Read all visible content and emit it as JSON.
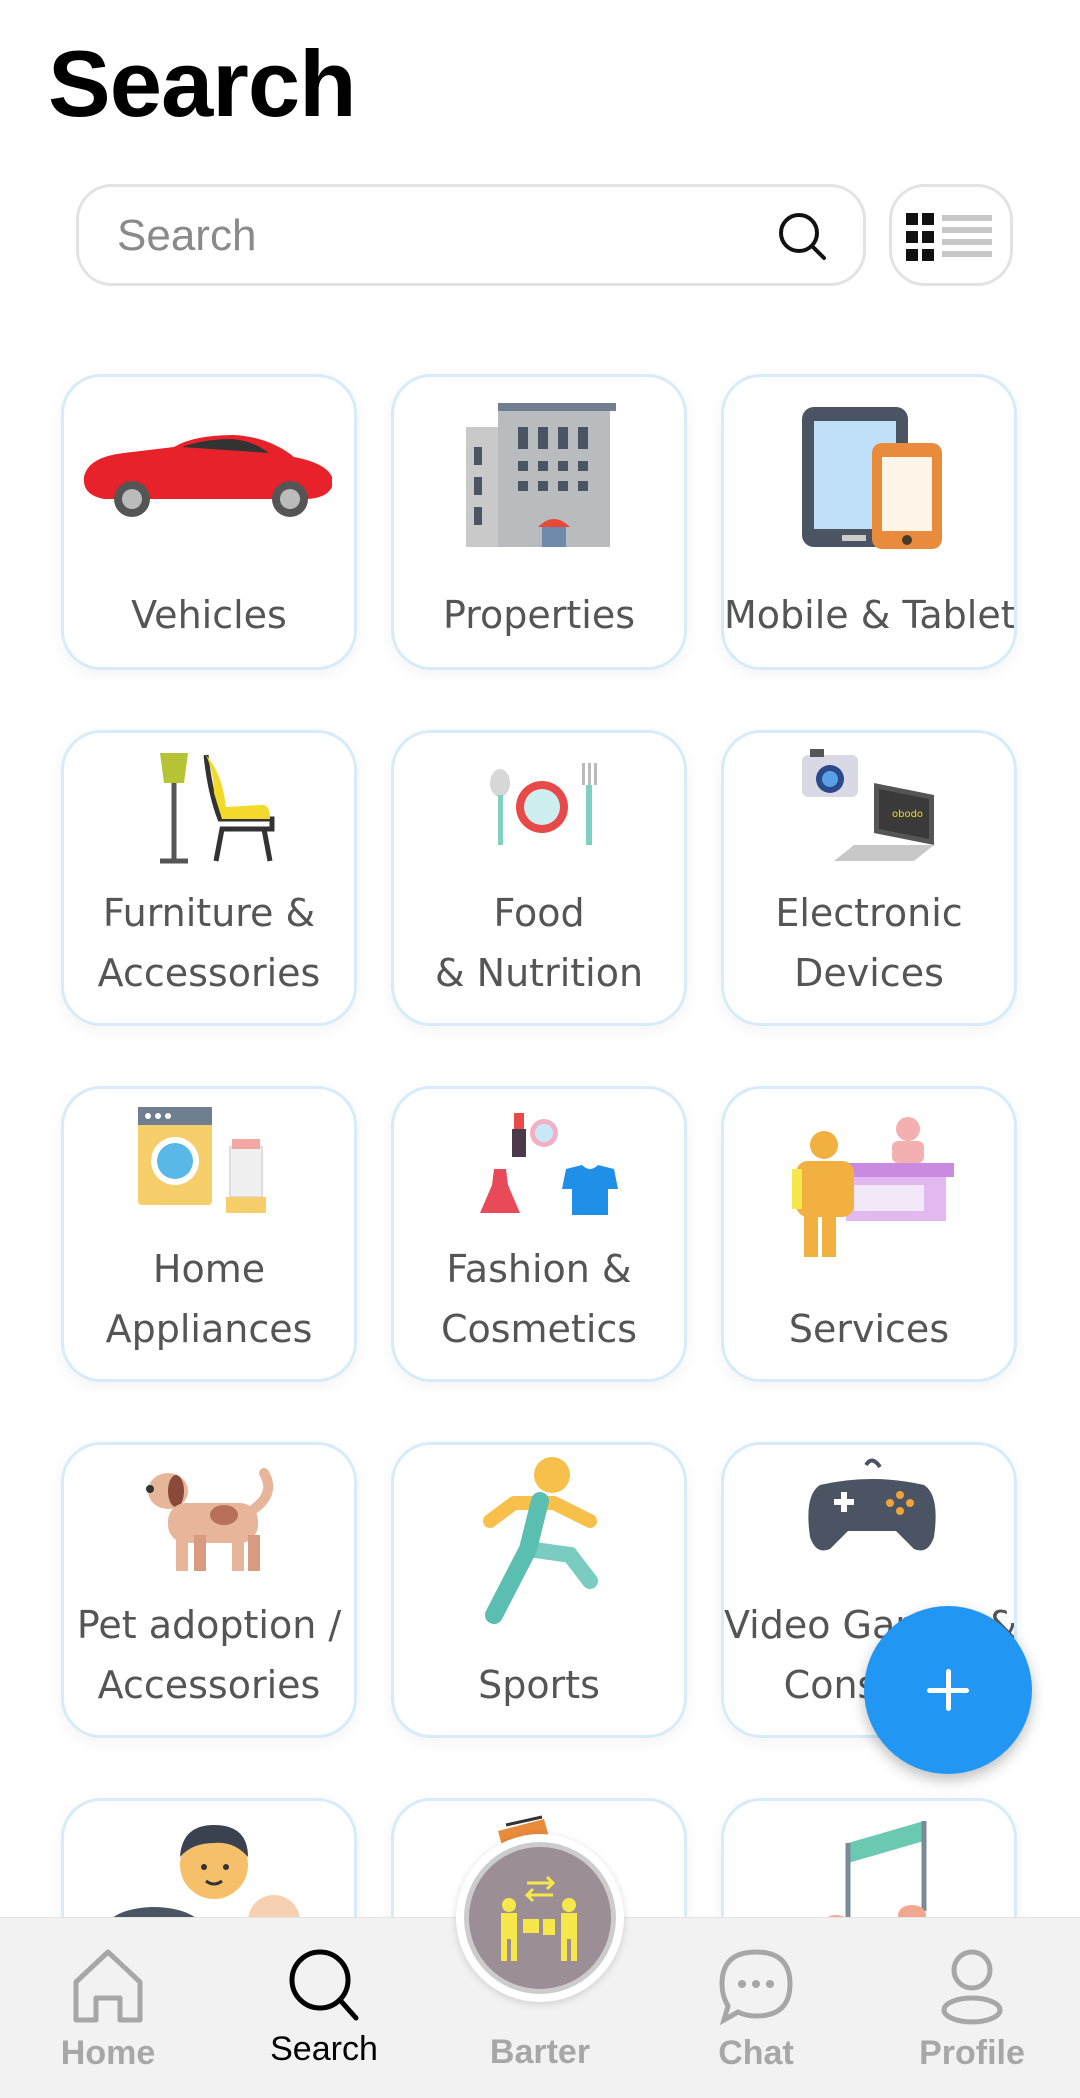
{
  "header": {
    "title": "Search"
  },
  "search": {
    "placeholder": "Search"
  },
  "categories": [
    {
      "label_lines": [
        "Vehicles"
      ],
      "icon": "car-icon"
    },
    {
      "label_lines": [
        "Properties"
      ],
      "icon": "building-icon"
    },
    {
      "label_lines": [
        "Mobile & Tablet"
      ],
      "icon": "mobile-tablet-icon"
    },
    {
      "label_lines": [
        "Furniture &",
        "Accessories"
      ],
      "icon": "lamp-chair-icon"
    },
    {
      "label_lines": [
        "Food",
        "& Nutrition"
      ],
      "icon": "plate-cutlery-icon"
    },
    {
      "label_lines": [
        "Electronic",
        "Devices"
      ],
      "icon": "camera-laptop-icon"
    },
    {
      "label_lines": [
        "Home",
        "Appliances"
      ],
      "icon": "washer-blender-icon"
    },
    {
      "label_lines": [
        "Fashion &",
        "Cosmetics"
      ],
      "icon": "dress-shirt-cosmetics-icon"
    },
    {
      "label_lines": [
        "Services"
      ],
      "icon": "reception-desk-icon"
    },
    {
      "label_lines": [
        "Pet adoption /",
        "Accessories"
      ],
      "icon": "dog-icon"
    },
    {
      "label_lines": [
        "Sports"
      ],
      "icon": "runner-icon"
    },
    {
      "label_lines": [
        "Video Games &",
        "Consoles"
      ],
      "icon": "gamepad-icon"
    },
    {
      "label_lines": [],
      "icon": "family-icon"
    },
    {
      "label_lines": [],
      "icon": "books-icon"
    },
    {
      "label_lines": [],
      "icon": "music-note-icon"
    }
  ],
  "fab": {
    "icon": "plus-icon"
  },
  "bottom_nav": {
    "home": "Home",
    "search": "Search",
    "barter": "Barter",
    "chat": "Chat",
    "profile": "Profile",
    "active": "search"
  },
  "colors": {
    "accent": "#2196f3",
    "tile_border": "#d6ecfa",
    "nav_inactive": "#a7a7a7"
  }
}
